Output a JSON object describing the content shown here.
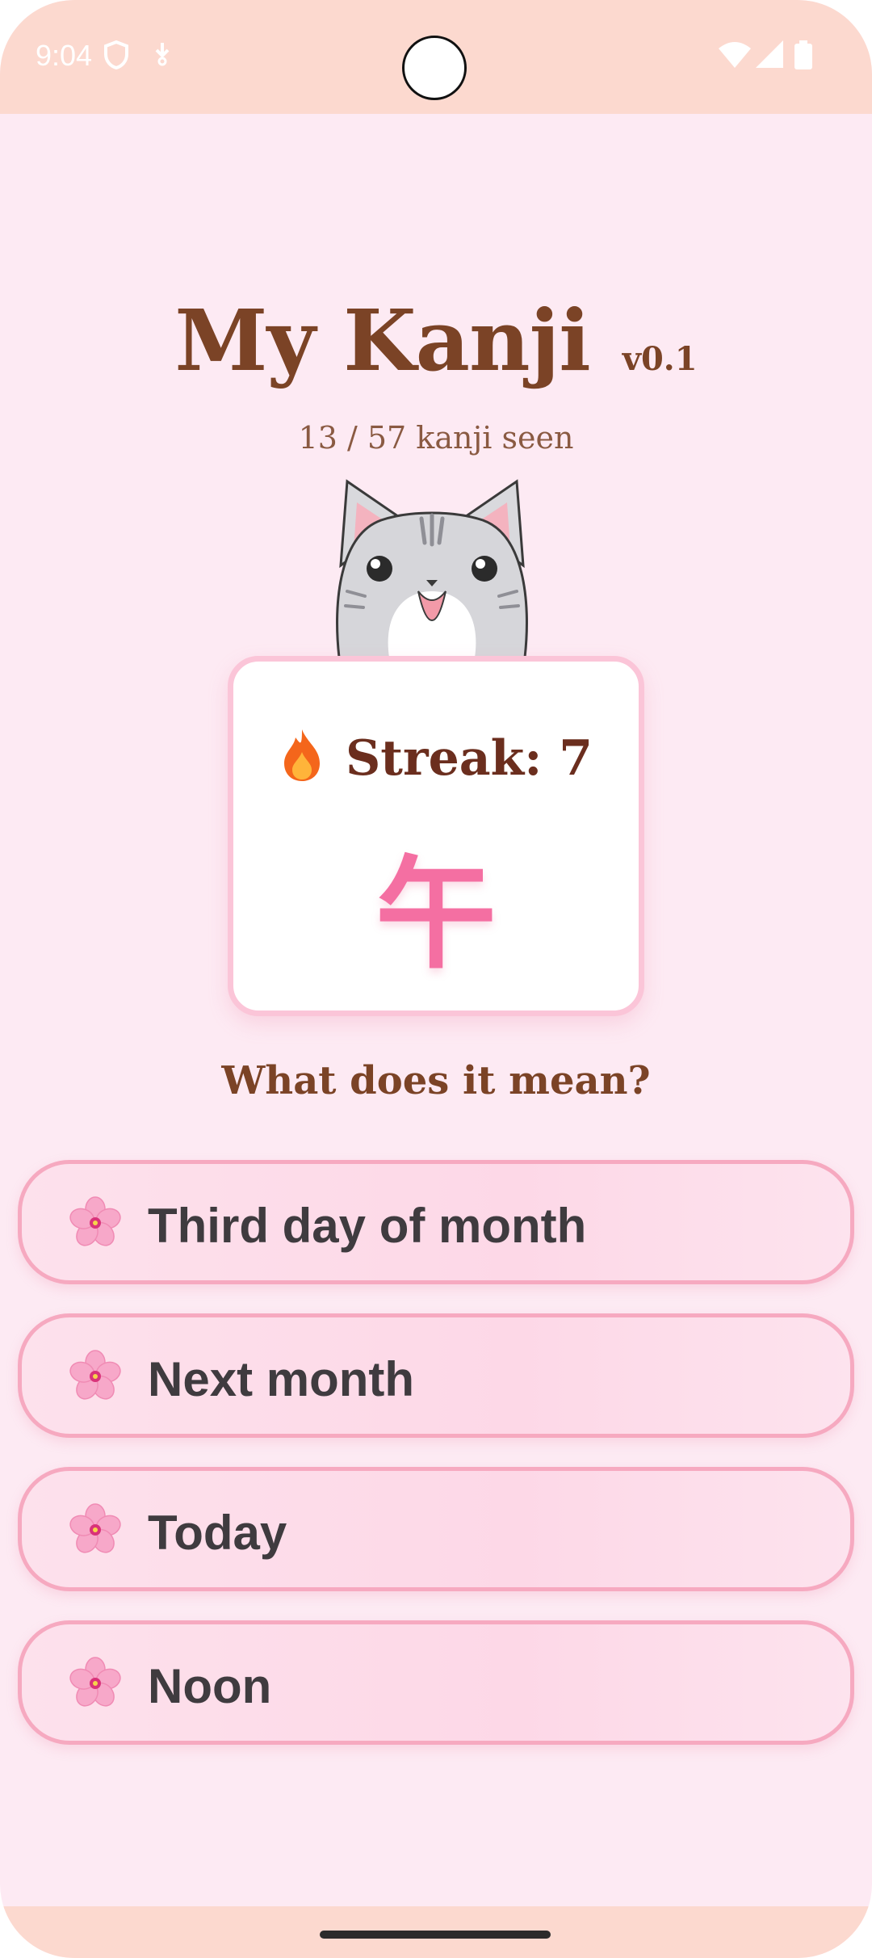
{
  "status_bar": {
    "time": "9:04"
  },
  "app": {
    "title": "My Kanji",
    "version": "v0.1",
    "progress_text": "13 / 57 kanji seen"
  },
  "card": {
    "streak_label": "Streak: 7",
    "kanji": "午"
  },
  "quiz": {
    "question": "What does it mean?",
    "options": [
      {
        "label": "Third day of month"
      },
      {
        "label": "Next month"
      },
      {
        "label": "Today"
      },
      {
        "label": "Noon"
      }
    ]
  },
  "icons": {
    "streak": "fire-icon",
    "option": "cherry-blossom-icon",
    "mascot": "cat-mascot"
  },
  "colors": {
    "background": "#fdeaf3",
    "status_bar": "#fcd9cf",
    "title": "#7b4326",
    "kanji": "#f46fa2",
    "option_border": "#f6a9c0"
  }
}
